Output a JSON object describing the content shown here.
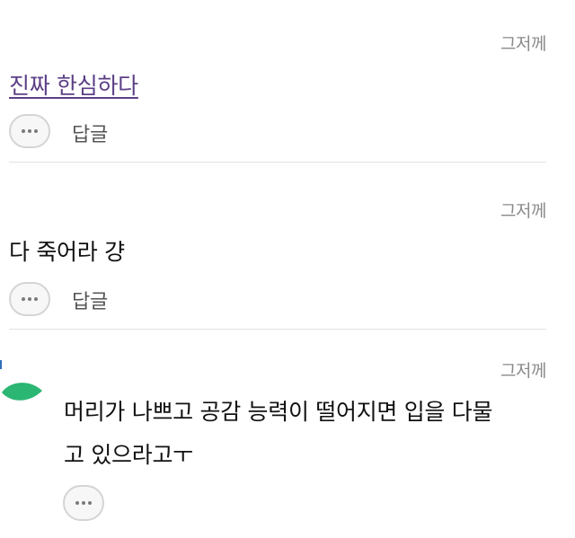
{
  "comments": [
    {
      "date": "그저께",
      "text": "진짜 한심하다",
      "reply_label": "답글",
      "more_icon": "ellipsis-icon"
    },
    {
      "date": "그저께",
      "text": "다 죽어라 걍",
      "reply_label": "답글",
      "more_icon": "ellipsis-icon"
    },
    {
      "date": "그저께",
      "text_line1": "머리가 나쁘고 공감 능력이 떨어지면 입을 다물",
      "text_line2": "고 있으라고ㅜ",
      "avatar_icon": "leaf-icon",
      "avatar_color": "#2bb673",
      "more_icon": "ellipsis-icon"
    }
  ],
  "colors": {
    "link": "#5b3f86",
    "date": "#8a8a8a",
    "divider": "#e2e2e2"
  }
}
